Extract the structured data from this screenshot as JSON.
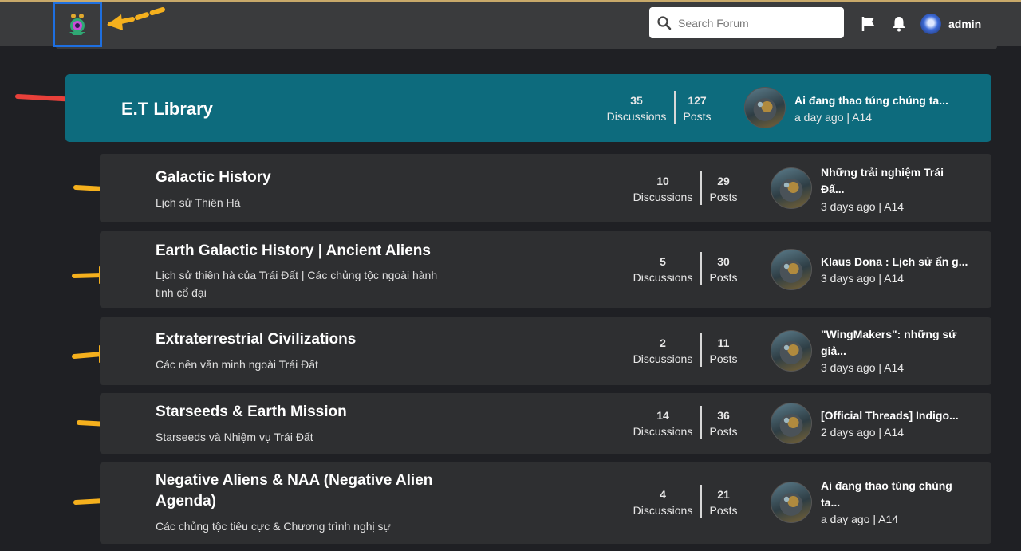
{
  "header": {
    "search_placeholder": "Search Forum",
    "username": "admin"
  },
  "main_category": {
    "title": "E.T Library",
    "discussions": "35",
    "discussions_label": "Discussions",
    "posts": "127",
    "posts_label": "Posts",
    "last_title": "Ai đang thao túng chúng ta...",
    "last_meta": "a day ago | A14"
  },
  "subcategories": [
    {
      "title": "Galactic History",
      "desc": "Lịch sử Thiên Hà",
      "discussions": "10",
      "posts": "29",
      "last_title_1": "Những trải nghiệm Trái",
      "last_title_2": "Đấ...",
      "last_meta": "3 days ago | A14"
    },
    {
      "title": "Earth Galactic History | Ancient Aliens",
      "desc_1": "Lịch sử thiên hà của Trái Đất | Các chủng tộc ngoài hành",
      "desc_2": "tinh cổ đại",
      "discussions": "5",
      "posts": "30",
      "last_title": "Klaus Dona : Lịch sử ẩn g...",
      "last_meta": "3 days ago | A14"
    },
    {
      "title": "Extraterrestrial Civilizations",
      "desc": "Các nền văn minh ngoài Trái Đất",
      "discussions": "2",
      "posts": "11",
      "last_title_1": "\"WingMakers\": những sứ",
      "last_title_2": "giả...",
      "last_meta": "3 days ago | A14"
    },
    {
      "title": "Starseeds & Earth Mission",
      "desc": "Starseeds và Nhiệm vụ Trái Đất",
      "discussions": "14",
      "posts": "36",
      "last_title": "[Official Threads] Indigo...",
      "last_meta": "2 days ago | A14"
    },
    {
      "title_1": "Negative Aliens & NAA (Negative Alien",
      "title_2": "Agenda)",
      "desc": "Các chủng tộc tiêu cực & Chương trình nghị sự",
      "discussions": "4",
      "posts": "21",
      "last_title_1": "Ai đang thao túng chúng",
      "last_title_2": "ta...",
      "last_meta": "a day ago | A14"
    }
  ],
  "labels": {
    "discussions": "Discussions",
    "posts": "Posts"
  },
  "colors": {
    "accent": "#0d6b7d",
    "arrow_orange": "#f5b01d",
    "arrow_red": "#e8403a",
    "highlight_box": "#1e6fe0"
  },
  "icons": [
    "logo-icon",
    "search-icon",
    "flag-icon",
    "bell-icon",
    "avatar",
    "arrow-annotation"
  ]
}
